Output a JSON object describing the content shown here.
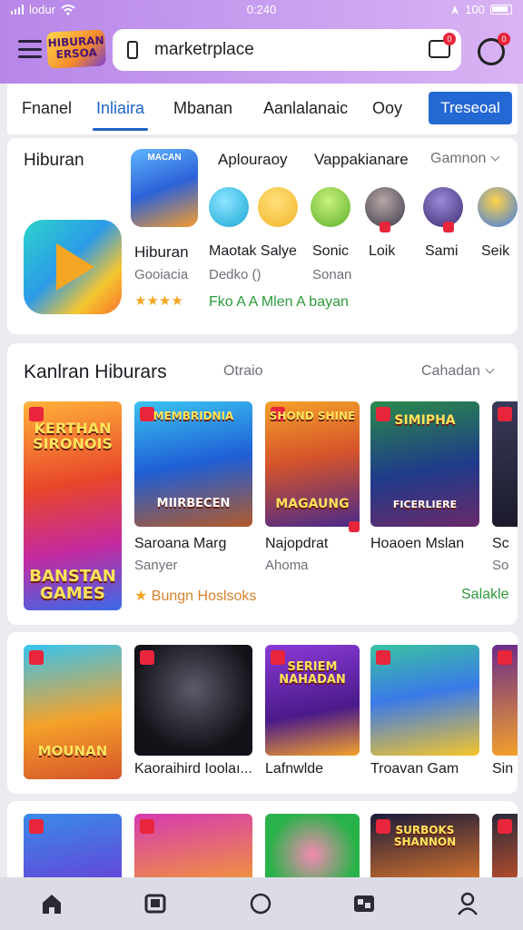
{
  "status_bar": {
    "carrier": "lodur",
    "time": "0:240",
    "battery": "100"
  },
  "header": {
    "logo_text": "HIBURAN ERSOA",
    "search_value": "marketrplace",
    "message_badge": "0",
    "profile_badge": "0"
  },
  "tabs": {
    "items": [
      "Fnanel",
      "Inliaira",
      "Mbanan",
      "Aanlalanaic",
      "Ooy"
    ],
    "active": "Inliaira",
    "button_label": "Treseoal"
  },
  "section1": {
    "title": "Hiburan",
    "featured_label": "MACAN",
    "heading2": "Aplouraoy",
    "heading3": "Vappakianare",
    "filter": "Gamnon",
    "apps": [
      {
        "name": "Hiburan",
        "sub": "Gooiacia"
      },
      {
        "name": "Maotak Salye",
        "sub": "Dedko ()"
      },
      {
        "name": "Sonic",
        "sub": "Sonan"
      },
      {
        "name": "Loik",
        "sub": ""
      },
      {
        "name": "Sami",
        "sub": ""
      },
      {
        "name": "Seik",
        "sub": ""
      }
    ],
    "rating_stars": "★★★★",
    "promo": "Fko A A Mlen A bayan"
  },
  "section2": {
    "title": "Kanlran Hiburars",
    "subtitle": "Otraio",
    "filter": "Cahadan",
    "tiles": [
      {
        "cap_top": "KERTHAN SIRONOIS",
        "cap_bottom": "BANSTAN GAMES",
        "name": "",
        "sub": ""
      },
      {
        "cap_top": "MEMBRIDNIA",
        "cap_bottom": "MIIRBECEN",
        "name": "Saroana Marg",
        "sub": "Sanyer"
      },
      {
        "cap_top": "SHOND SHINE",
        "cap_bottom": "MAGAUNG",
        "name": "Najopdrat",
        "sub": "Ahoma"
      },
      {
        "cap_top": "SIMIPHA",
        "cap_bottom": "FICERLIERE",
        "name": "Hoaoen Mslan",
        "sub": ""
      },
      {
        "cap_top": "",
        "cap_bottom": "",
        "name": "Sc",
        "sub": "So"
      }
    ],
    "footer_left": "Bungn Hoslsoks",
    "footer_right": "Salakle"
  },
  "section3": {
    "tiles": [
      {
        "cap_top": "",
        "cap_bottom": "MOUNAN",
        "name": ""
      },
      {
        "cap_top": "",
        "cap_bottom": "",
        "name": "Kaoraihird Ioolaı..."
      },
      {
        "cap_top": "SERIEM NAHADAN",
        "cap_bottom": "",
        "name": "Lafnwlde"
      },
      {
        "cap_top": "",
        "cap_bottom": "",
        "name": "Troavan Gam"
      },
      {
        "cap_top": "",
        "cap_bottom": "",
        "name": "Sin"
      }
    ]
  },
  "section4": {
    "tiles": [
      {
        "cap": ""
      },
      {
        "cap": ""
      },
      {
        "cap": ""
      },
      {
        "cap": "SURBOKS SHANNON"
      },
      {
        "cap": ""
      }
    ]
  },
  "colors": {
    "accent": "#2064c8",
    "header_gradient_start": "#b786e8",
    "badge": "#e8253a",
    "green_text": "#2f9a3c",
    "orange_text": "#d9822b"
  },
  "icons": [
    "home-icon",
    "library-icon",
    "circle-icon",
    "games-icon",
    "profile-icon"
  ]
}
